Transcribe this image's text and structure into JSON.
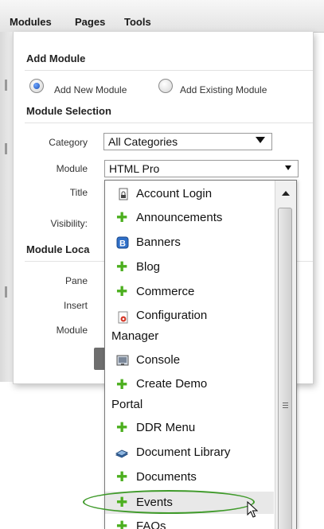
{
  "menubar": {
    "items": [
      "Modules",
      "Pages",
      "Tools"
    ]
  },
  "add_module": {
    "title": "Add Module",
    "radio_new_label": "Add New Module",
    "radio_existing_label": "Add Existing Module",
    "selected": "Add New Module"
  },
  "module_selection": {
    "title": "Module Selection",
    "category_label": "Category",
    "category_value": "All Categories",
    "module_label": "Module",
    "module_value": "HTML Pro",
    "title_label": "Title",
    "visibility_label": "Visibility:"
  },
  "module_location": {
    "title": "Module Loca",
    "pane_label": "Pane",
    "insert_label": "Insert",
    "module_label": "Module"
  },
  "dropdown": {
    "items": [
      {
        "label": "Account Login",
        "icon": "login-page-icon"
      },
      {
        "label": "Announcements",
        "icon": "puzzle-icon"
      },
      {
        "label": "Banners",
        "icon": "banners-icon"
      },
      {
        "label": "Blog",
        "icon": "puzzle-icon"
      },
      {
        "label": "Commerce",
        "icon": "puzzle-icon"
      },
      {
        "label": "Configuration",
        "label2": "Manager",
        "icon": "configuration-icon"
      },
      {
        "label": "Console",
        "icon": "console-icon"
      },
      {
        "label": "Create Demo",
        "label2": "Portal",
        "icon": "puzzle-icon"
      },
      {
        "label": "DDR Menu",
        "icon": "puzzle-icon"
      },
      {
        "label": "Document Library",
        "icon": "document-library-icon"
      },
      {
        "label": "Documents",
        "icon": "puzzle-icon"
      },
      {
        "label": "Events",
        "icon": "puzzle-icon"
      },
      {
        "label": "FAQs",
        "icon": "puzzle-icon"
      }
    ],
    "hovered": "Events"
  },
  "colors": {
    "puzzle": "#4caf1f",
    "highlight": "#3f9a2a",
    "radio_selected": "#1a4db3"
  }
}
